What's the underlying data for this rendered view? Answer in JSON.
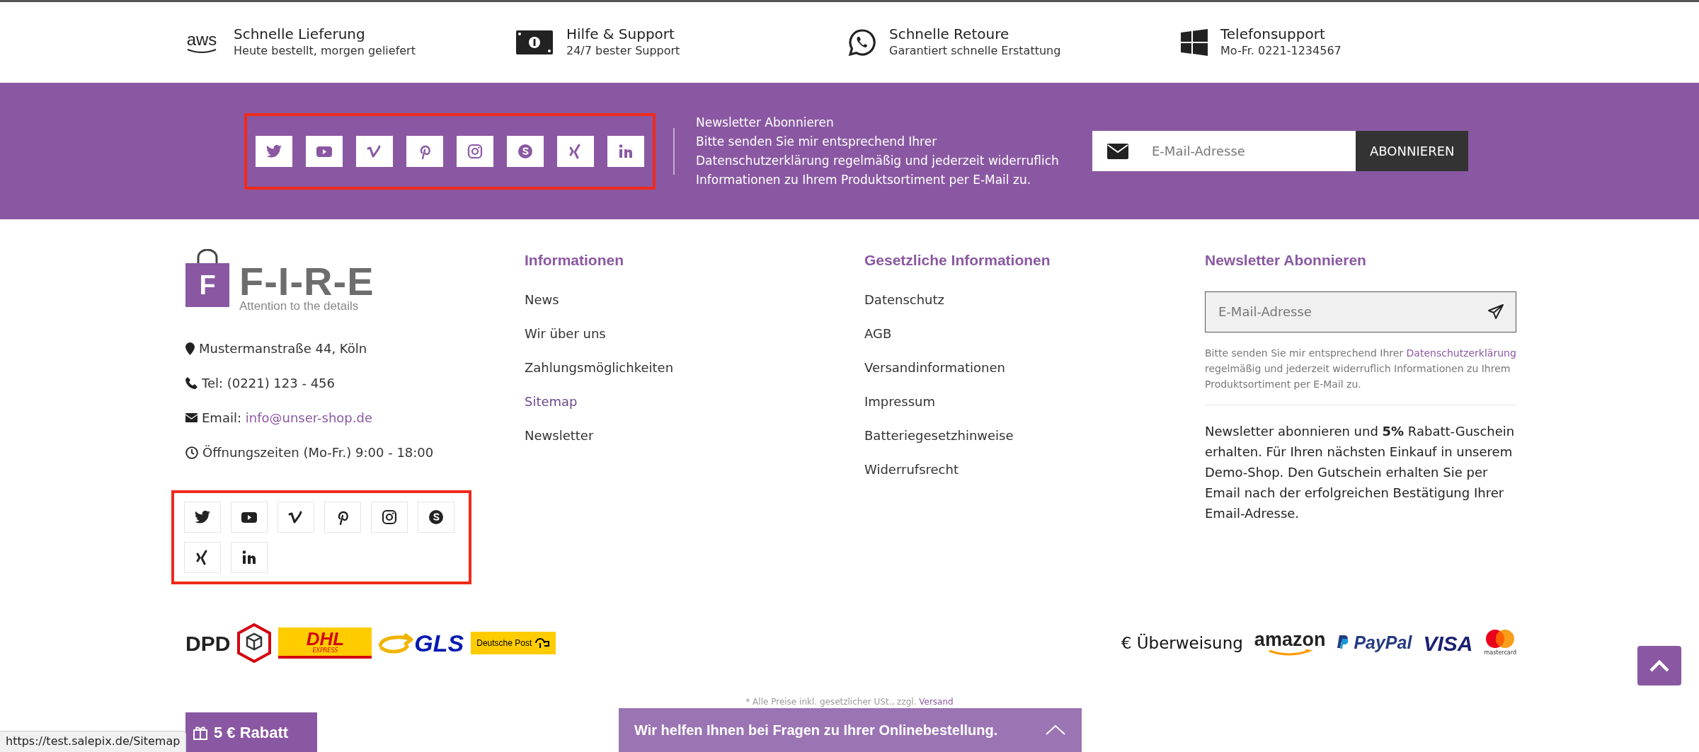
{
  "features": [
    {
      "kind": "aws",
      "logo": "aws",
      "title": "Schnelle Lieferung",
      "subtitle": "Heute bestellt, morgen geliefert"
    },
    {
      "kind": "bill",
      "title": "Hilfe & Support",
      "subtitle": "24/7 bester Support"
    },
    {
      "kind": "whatsapp",
      "title": "Schnelle Retoure",
      "subtitle": "Garantiert schnelle Erstattung"
    },
    {
      "kind": "windows",
      "title": "Telefonsupport",
      "subtitle": "Mo-Fr. 0221-1234567"
    }
  ],
  "newsletter_band": {
    "social_links": [
      {
        "kind": "twitter"
      },
      {
        "kind": "youtube"
      },
      {
        "kind": "vimeo"
      },
      {
        "kind": "pinterest"
      },
      {
        "kind": "instagram"
      },
      {
        "kind": "skype"
      },
      {
        "kind": "xing"
      },
      {
        "kind": "linkedin"
      }
    ],
    "title": "Newsletter Abonnieren",
    "text": "Bitte senden Sie mir entsprechend Ihrer Datenschutzerklärung regelmäßig und jederzeit widerruflich Informationen zu Ihrem Produktsortiment per E-Mail zu.",
    "placeholder": "E-Mail-Adresse",
    "button": "ABONNIEREN"
  },
  "brand": {
    "letter": "F",
    "name": "F-I-R-E",
    "tagline": "Attention to the details"
  },
  "contact": [
    {
      "kind": "address",
      "text": "Mustermanstraße 44, Köln"
    },
    {
      "kind": "phone",
      "text": "Tel: (0221) 123 - 456"
    },
    {
      "kind": "email",
      "text": "Email: ",
      "link": "info@unser-shop.de"
    },
    {
      "kind": "clock",
      "text": "Öffnungszeiten (Mo-Fr.) 9:00 - 18:00"
    }
  ],
  "footer_social_links": [
    {
      "kind": "twitter"
    },
    {
      "kind": "youtube"
    },
    {
      "kind": "vimeo"
    },
    {
      "kind": "pinterest"
    },
    {
      "kind": "instagram"
    },
    {
      "kind": "skype"
    },
    {
      "kind": "xing"
    },
    {
      "kind": "linkedin"
    }
  ],
  "columns": [
    {
      "title": "Informationen",
      "links": [
        {
          "label": "News",
          "hovered": false
        },
        {
          "label": "Wir über uns",
          "hovered": false
        },
        {
          "label": "Zahlungsmöglichkeiten",
          "hovered": false
        },
        {
          "label": "Sitemap",
          "hovered": true
        },
        {
          "label": "Newsletter",
          "hovered": false
        }
      ]
    },
    {
      "title": "Gesetzliche Informationen",
      "links": [
        {
          "label": "Datenschutz",
          "hovered": false
        },
        {
          "label": "AGB",
          "hovered": false
        },
        {
          "label": "Versandinformationen",
          "hovered": false
        },
        {
          "label": "Impressum",
          "hovered": false
        },
        {
          "label": "Batteriegesetzhinweise",
          "hovered": false
        },
        {
          "label": "Widerrufsrecht",
          "hovered": false
        }
      ]
    }
  ],
  "newsletter": {
    "title": "Newsletter Abonnieren",
    "placeholder": "E-Mail-Adresse",
    "consent_before": "Bitte senden Sie mir entsprechend Ihrer ",
    "consent_link": "Datenschutzerklärung",
    "consent_after": " regelmäßig und jederzeit widerruflich Informationen zu Ihrem Produktsortiment per E-Mail zu.",
    "promo": "Newsletter abonnieren und **5%** Rabatt-Guschein erhalten. Für Ihren nächsten Einkauf in unserem Demo-Shop. Den Gutschein erhalten Sie per Email nach der erfolgreichen Bestätigung Ihrer Email-Adresse."
  },
  "shipping_logos": [
    {
      "kind": "dpd",
      "text": "DPD"
    },
    {
      "kind": "dhl",
      "text": "DHL",
      "subtext": "EXPRESS"
    },
    {
      "kind": "gls",
      "text": "GLS"
    },
    {
      "kind": "deutsche_post",
      "text": "Deutsche Post"
    }
  ],
  "payment_logos": [
    {
      "kind": "transfer",
      "text": "€ Überweisung"
    },
    {
      "kind": "amazon",
      "text": "amazon"
    },
    {
      "kind": "paypal",
      "text": "PayPal"
    },
    {
      "kind": "visa",
      "text": "VISA"
    },
    {
      "kind": "mastercard",
      "text": "mastercard"
    }
  ],
  "footnote": {
    "text": "* Alle Preise inkl. gesetzlicher USt., zzgl. ",
    "link": "Versand"
  },
  "discount_button": "5 € Rabatt",
  "chat_bar": "Wir helfen Ihnen bei Fragen zu Ihrer Onlinebestellung.",
  "status_url": "https://test.salepix.de/Sitemap"
}
